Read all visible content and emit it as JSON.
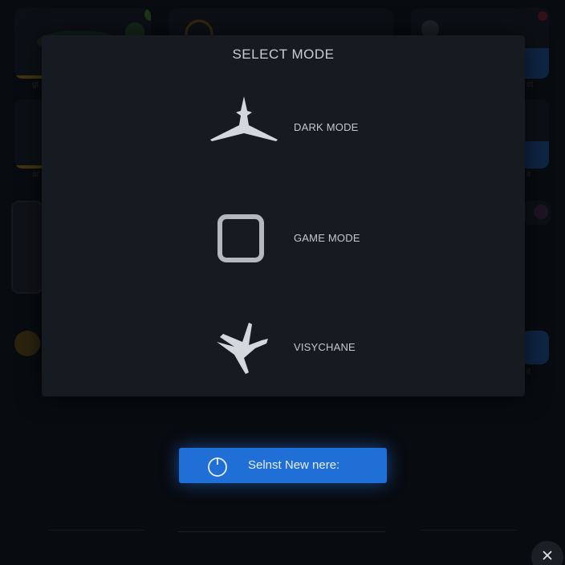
{
  "dialog": {
    "title": "SELECT MODE",
    "modes": [
      {
        "label": "DARK MODE",
        "icon": "airplane-top-icon"
      },
      {
        "label": "GAME MODE",
        "icon": "square-icon"
      },
      {
        "label": "VISYCHANE",
        "icon": "airplane-side-icon"
      }
    ],
    "primary_button": {
      "label": "Selnst New nere:",
      "icon": "power-icon"
    }
  },
  "close_button": {
    "icon": "close-icon",
    "symbol": "×"
  },
  "background": {
    "tile_labels": [
      "gt",
      "ar",
      "et",
      "it",
      "it"
    ]
  },
  "colors": {
    "accent": "#1f6fd6",
    "dialog_bg": "#161b22",
    "text": "#c4c8ce",
    "highlight_bar": "#8a6d12"
  }
}
